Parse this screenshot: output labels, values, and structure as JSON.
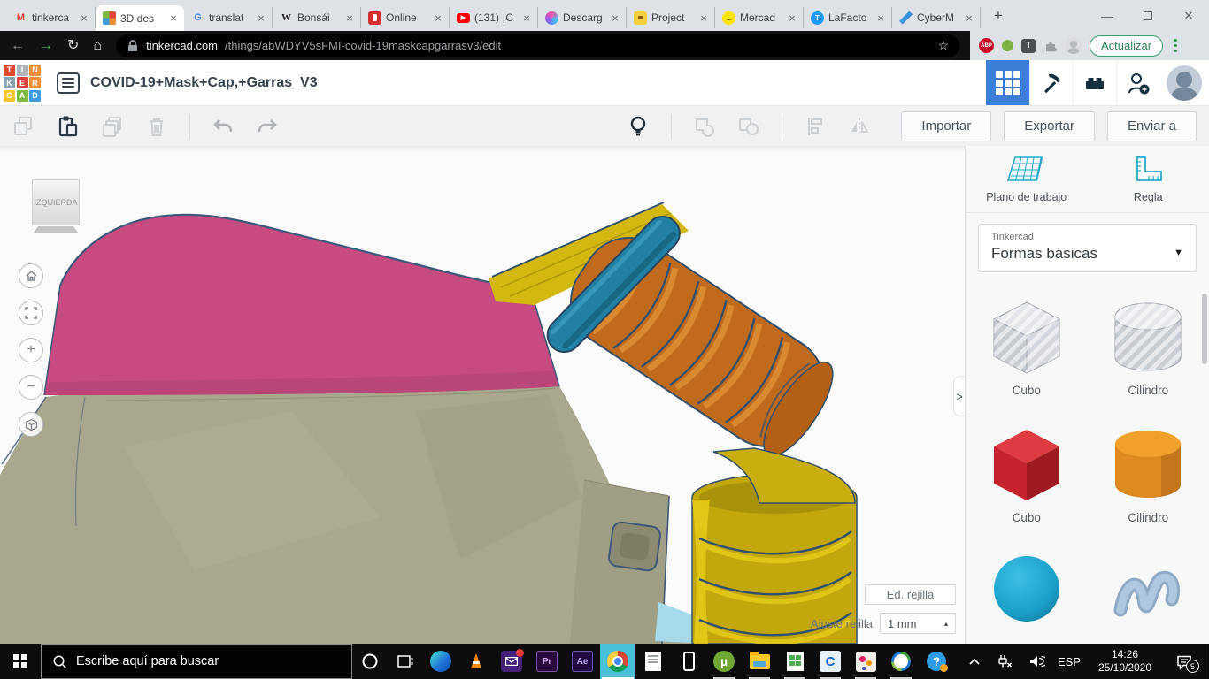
{
  "browser": {
    "tabs": [
      {
        "title": "tinkerca"
      },
      {
        "title": "3D des"
      },
      {
        "title": "translat"
      },
      {
        "title": "Bonsái"
      },
      {
        "title": "Online"
      },
      {
        "title": "(131) ¡C"
      },
      {
        "title": "Descarg"
      },
      {
        "title": "Project"
      },
      {
        "title": "Mercad"
      },
      {
        "title": "LaFacto"
      },
      {
        "title": "CyberM"
      }
    ],
    "url": {
      "host": "tinkercad.com",
      "path": "/things/abWDYV5sFMI-covid-19maskcapgarrasv3/edit"
    },
    "update_button": "Actualizar"
  },
  "header": {
    "title": "COVID-19+Mask+Cap,+Garras_V3"
  },
  "actionbar": {
    "import": "Importar",
    "export": "Exportar",
    "send": "Enviar a"
  },
  "canvas": {
    "viewcube_label": "IZQUIERDA",
    "edit_grid": "Ed. rejilla",
    "snap_label": "Ajuste rejilla",
    "snap_value": "1 mm"
  },
  "panel": {
    "workplane": "Plano de trabajo",
    "ruler": "Regla",
    "library_label": "Tinkercad",
    "library_value": "Formas básicas",
    "shapes": [
      {
        "label": "Cubo"
      },
      {
        "label": "Cilindro"
      },
      {
        "label": "Cubo"
      },
      {
        "label": "Cilindro"
      },
      {
        "label": ""
      },
      {
        "label": ""
      }
    ]
  },
  "taskbar": {
    "search_placeholder": "Escribe aquí para buscar",
    "language": "ESP",
    "time": "14:26",
    "date": "25/10/2020",
    "notification_count": "5"
  },
  "logo": {
    "letters": [
      "T",
      "I",
      "N",
      "K",
      "E",
      "R",
      "C",
      "A",
      "D"
    ]
  },
  "icons": {
    "back": "←",
    "forward": "→",
    "reload": "↻",
    "home": "⌂",
    "star": "☆",
    "gmail": "M",
    "google": "G",
    "wikipedia": "W",
    "youtube": "▶",
    "lafactoria": "T",
    "abp": "ABP",
    "tampermonkey": "T",
    "premiere": "Pr",
    "aftereffects": "Ae",
    "utorrent": "µ",
    "camtasia": "C",
    "help": "?",
    "caret_down": "▼",
    "caret_up": "▴",
    "collapse": ">",
    "close": "×",
    "new_tab": "+",
    "minimize": "—",
    "plus": "+",
    "minus": "−"
  },
  "colors": {
    "accent_blue": "#3D7FD8",
    "tinkercad_teal": "#2AA8CB",
    "chrome_active_highlight": "#48C1D8",
    "model_khaki": "#A9A78E",
    "model_pink": "#C74A80",
    "model_gold": "#C9AE10",
    "model_orange": "#C06A1C",
    "model_teal_cap": "#2180A4"
  }
}
